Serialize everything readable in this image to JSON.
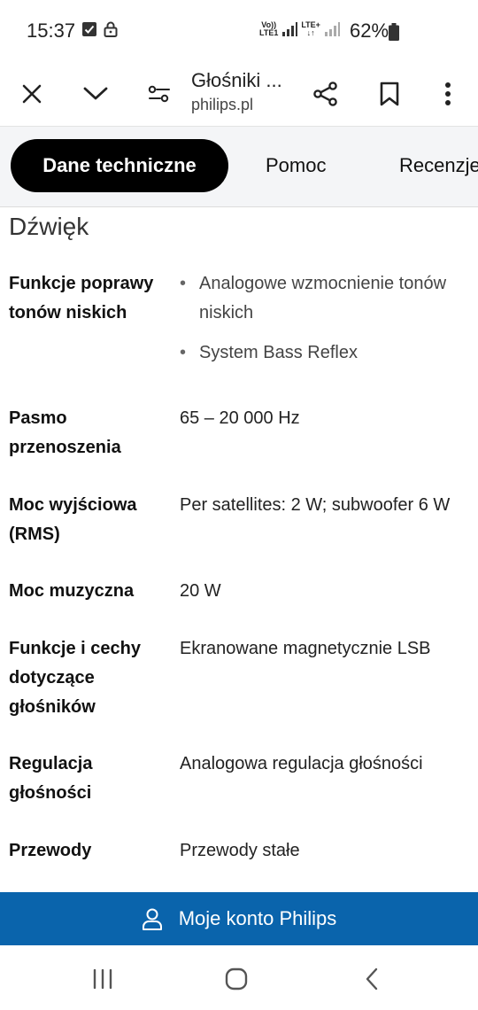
{
  "status_bar": {
    "time": "15:37",
    "volte": "Vo))",
    "lte1": "LTE1",
    "lte_plus": "LTE+",
    "battery": "62%"
  },
  "toolbar": {
    "title": "Głośniki ...",
    "url": "philips.pl"
  },
  "tabs": [
    {
      "label": "Dane techniczne",
      "active": true
    },
    {
      "label": "Pomoc",
      "active": false
    },
    {
      "label": "Recenzje",
      "active": false
    }
  ],
  "section": {
    "title": "Dźwięk"
  },
  "specs": [
    {
      "label": "Funkcje poprawy tonów niskich",
      "bullets": [
        "Analogowe wzmocnienie tonów niskich",
        "System Bass Reflex"
      ]
    },
    {
      "label": "Pasmo przenoszenia",
      "value": "65 – 20 000  Hz"
    },
    {
      "label": "Moc wyjściowa (RMS)",
      "value": "Per satellites: 2 W; subwoofer 6 W"
    },
    {
      "label": "Moc muzyczna",
      "value": "20  W"
    },
    {
      "label": "Funkcje i cechy dotyczące głośników",
      "value": "Ekranowane magnetycznie LSB"
    },
    {
      "label": "Regulacja głośności",
      "value": "Analogowa regulacja głośności"
    },
    {
      "label": "Przewody",
      "value": "Przewody stałe"
    }
  ],
  "account_bar": {
    "label": "Moje konto Philips"
  },
  "colors": {
    "accent": "#0a64ac",
    "active_tab": "#000000",
    "tabs_bg": "#f4f5f7"
  }
}
